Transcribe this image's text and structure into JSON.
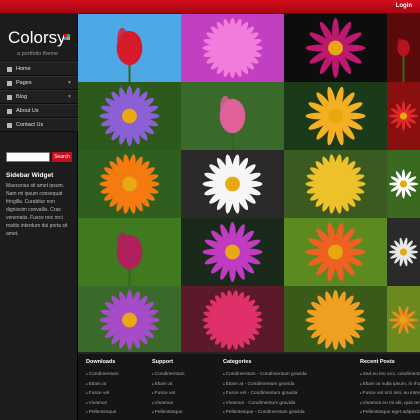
{
  "topbar": {
    "login": "Login"
  },
  "brand": {
    "name": "Colorsy",
    "tagline": "a portfolio theme",
    "square_colors": [
      "#d11",
      "#1b4",
      "#29f",
      "#f90"
    ]
  },
  "nav": [
    {
      "label": "Home",
      "icon": "home-icon",
      "arrow": ""
    },
    {
      "label": "Pages",
      "icon": "pages-icon",
      "arrow": "▼"
    },
    {
      "label": "Blog",
      "icon": "blog-icon",
      "arrow": "▼"
    },
    {
      "label": "About Us",
      "icon": "about-icon",
      "arrow": ""
    },
    {
      "label": "Contact Us",
      "icon": "contact-icon",
      "arrow": ""
    }
  ],
  "search": {
    "placeholder": "",
    "button": "Search"
  },
  "widget": {
    "title": "Sidebar Widget",
    "text": "Maecenas sit amet ipsum. Nam mi ipsum consequat fringilla. Curabitur non dignissim convallis. Cras venenatis. Fusce nec orci mattis interdum dui porta sit amet."
  },
  "gallery": {
    "tiles": [
      {
        "name": "red-tulips-photo"
      },
      {
        "name": "pink-dahlia-photo"
      },
      {
        "name": "dark-pink-flowers-photo"
      },
      {
        "name": "red-leaves-photo"
      },
      {
        "name": "purple-asters-photo"
      },
      {
        "name": "pink-tulip-photo"
      },
      {
        "name": "mixed-gerberas-photo"
      },
      {
        "name": "red-daisies-photo"
      },
      {
        "name": "orange-gerbera-photo"
      },
      {
        "name": "white-daisy-photo"
      },
      {
        "name": "yellow-pink-flower-photo"
      },
      {
        "name": "white-flowers-photo"
      },
      {
        "name": "lilies-photo"
      },
      {
        "name": "osteospermum-photo"
      },
      {
        "name": "butterfly-flower-photo"
      },
      {
        "name": "dark-daisy-photo"
      },
      {
        "name": "purple-daisy-photo"
      },
      {
        "name": "pink-dahlia-photo-2"
      },
      {
        "name": "orange-dahlia-photo"
      },
      {
        "name": "orange-flower-field-photo"
      }
    ]
  },
  "footer": {
    "cols": [
      {
        "title": "Downloads",
        "items": [
          "Condimentum",
          "Etiam at",
          "Fusce vel",
          "Vivamus",
          "Pellentesque"
        ]
      },
      {
        "title": "Support",
        "items": [
          "Condimentum",
          "Etiam at",
          "Fusce vel",
          "Vivamus",
          "Pellentesque"
        ]
      },
      {
        "title": "Categories",
        "items": [
          "Condimentum - Condimentum gravida",
          "Etiam at - Condimentum gravida",
          "Fusce vel - Condimentum gravida",
          "Vivamus - Condimentum gravida",
          "Pellentesque - Condimentum gravida"
        ]
      },
      {
        "title": "Recent Posts",
        "items": [
          "Sed eu leo orci, condimentum gravida",
          "Etiam at nulla ipsum, in rhoncus",
          "Fusce vel orci nisi, eu interdum",
          "Vivamus eu mi elit, quis tempor",
          "Pellentesque eget adipiscing"
        ]
      }
    ]
  }
}
